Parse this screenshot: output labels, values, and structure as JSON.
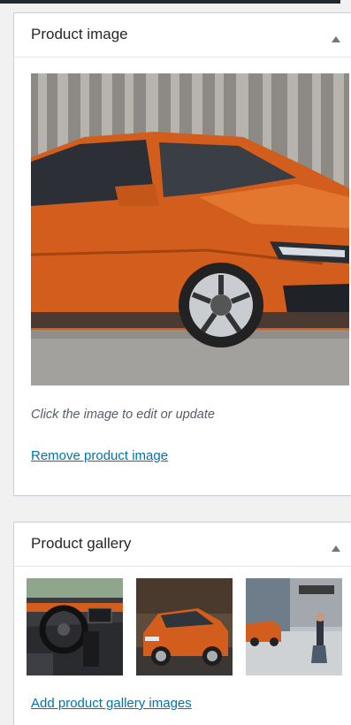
{
  "product_image_box": {
    "title": "Product image",
    "hint": "Click the image to edit or update",
    "remove_link": "Remove product image"
  },
  "gallery_box": {
    "title": "Product gallery",
    "add_link": "Add product gallery images",
    "thumbnails": [
      {
        "subject": "car-interior-dashboard"
      },
      {
        "subject": "orange-car-on-road"
      },
      {
        "subject": "orange-car-on-street"
      }
    ]
  },
  "colors": {
    "link": "#0073aa",
    "car_orange": "#d35d1c",
    "border": "#ccd0d4"
  },
  "icons": {
    "collapse": "triangle-up-icon"
  }
}
